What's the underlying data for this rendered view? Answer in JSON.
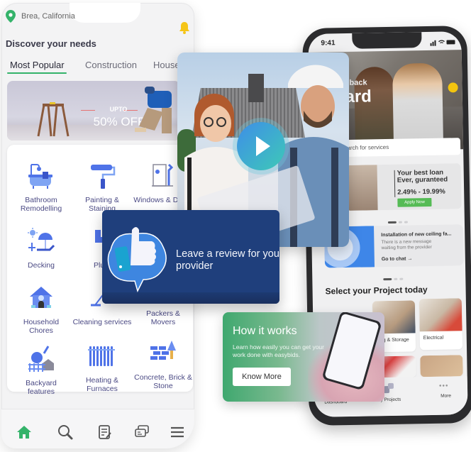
{
  "left_app": {
    "location": "Brea, California",
    "heading": "Discover your needs",
    "tabs": [
      {
        "label": "Most Popular",
        "active": true
      },
      {
        "label": "Construction",
        "active": false
      },
      {
        "label": "Househ",
        "active": false
      }
    ],
    "banner": {
      "upto": "UPTO",
      "offer": "50% OFF"
    },
    "services": [
      {
        "label": "Bathroom Remodelling",
        "icon": "bathtub-icon"
      },
      {
        "label": "Painting & Staining",
        "icon": "paint-roller-icon"
      },
      {
        "label": "Windows & Doors",
        "icon": "window-door-icon"
      },
      {
        "label": "Decking",
        "icon": "deck-chair-icon"
      },
      {
        "label": "Plum",
        "icon": "plumbing-pipe-icon"
      },
      {
        "label": "Household Chores",
        "icon": "house-icon"
      },
      {
        "label": "Cleaning services",
        "icon": "mop-icon"
      },
      {
        "label": "Packers & Movers",
        "icon": "moving-box-icon"
      },
      {
        "label": "Backyard features",
        "icon": "backyard-icon"
      },
      {
        "label": "Heating & Furnaces",
        "icon": "radiator-icon"
      },
      {
        "label": "Concrete, Brick & Stone",
        "icon": "brick-trowel-icon"
      }
    ],
    "bottom_nav": [
      "home-icon",
      "search-icon",
      "document-edit-icon",
      "chat-bubbles-icon",
      "menu-icon"
    ],
    "colors": {
      "accent": "#34b36a",
      "service_text": "#4b4a84",
      "icon_blue": "#4f73e8",
      "bell": "#f5c518"
    }
  },
  "video_card": {
    "play_icon": "play-icon"
  },
  "review_card": {
    "text": "Leave a review for you provider",
    "icon": "thumbs-up-icon",
    "bg": "#1f3f7c"
  },
  "how_card": {
    "title": "How it works",
    "subtitle": "Learn how easily you can get your work done with easybids.",
    "button": "Know More"
  },
  "right_app": {
    "time": "9:41",
    "welcome": "me back",
    "name": "hard",
    "search_placeholder": "earch for services",
    "loan": {
      "title": "Your best loan Ever, guranteed",
      "rate": "2.49% - 19.99%",
      "button": "Apply Now"
    },
    "chat": {
      "title": "Installation of new ceiling fa...",
      "message": "There is a new message waiting from the provider",
      "link": "Go to chat →"
    },
    "section_title": "Select your Project today",
    "projects": [
      "ving & Storage",
      "Electrical"
    ],
    "bottom_nav": [
      "Dashboard",
      "My Projects",
      "More"
    ]
  }
}
